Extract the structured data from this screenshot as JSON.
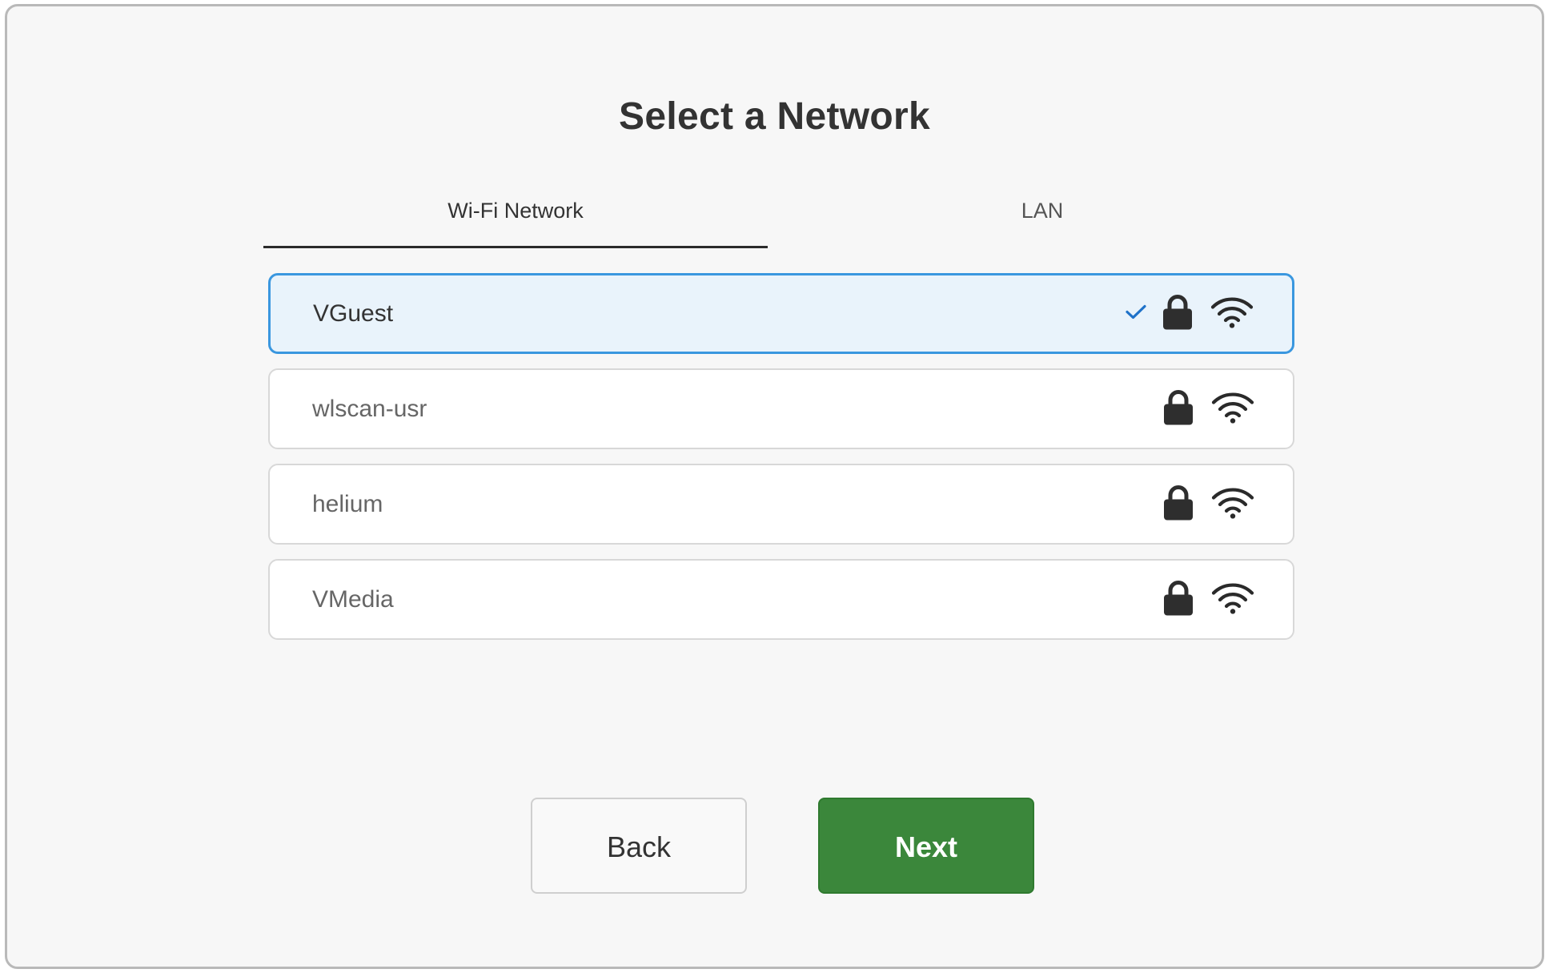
{
  "page": {
    "title": "Select a Network"
  },
  "tabs": [
    {
      "label": "Wi-Fi Network",
      "active": true
    },
    {
      "label": "LAN",
      "active": false
    }
  ],
  "networks": [
    {
      "name": "VGuest",
      "selected": true,
      "secured": true,
      "signal": "full"
    },
    {
      "name": "wlscan-usr",
      "selected": false,
      "secured": true,
      "signal": "full"
    },
    {
      "name": "helium",
      "selected": false,
      "secured": true,
      "signal": "full"
    },
    {
      "name": "VMedia",
      "selected": false,
      "secured": true,
      "signal": "full"
    }
  ],
  "buttons": {
    "back_label": "Back",
    "next_label": "Next"
  },
  "colors": {
    "accent_selected_border": "#3a97df",
    "selected_background": "#e9f3fb",
    "checkmark": "#1f72c9",
    "next_button": "#3b873b"
  },
  "icons": {
    "selected": "check-icon",
    "secured": "lock-icon",
    "signal": "wifi-icon"
  }
}
